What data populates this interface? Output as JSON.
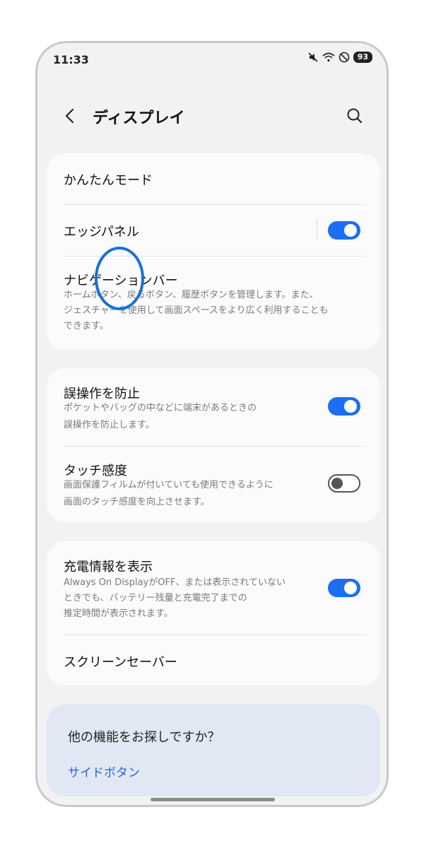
{
  "status_bar": {
    "time": "11:33",
    "battery": "93",
    "icons": [
      "mute-icon",
      "wifi-icon",
      "do-not-disturb-icon",
      "battery-icon"
    ]
  },
  "header": {
    "title": "ディスプレイ",
    "back_icon": "back-chevron-icon",
    "search_icon": "search-icon"
  },
  "group1": {
    "easy_mode": "かんたんモード",
    "edge_panel": {
      "title": "エッジパネル",
      "enabled": true
    },
    "nav_bar": {
      "title": "ナビゲーションバー",
      "sub_line1": "ホームボタン、戻るボタン、履歴ボタンを管理します。また、",
      "sub_line2": "ジェスチャーを使用して画面スペースをより広く利用することも",
      "sub_line3": "できます。"
    }
  },
  "group2": {
    "accidental_touch": {
      "title": "誤操作を防止",
      "sub_line1": "ポケットやバッグの中などに端末があるときの",
      "sub_line2": "誤操作を防止します。",
      "enabled": true
    },
    "touch_sensitivity": {
      "title": "タッチ感度",
      "sub_line1": "画面保護フィルムが付いていても使用できるように",
      "sub_line2": "画面のタッチ感度を向上させます。",
      "enabled": false
    }
  },
  "group3": {
    "charging_info": {
      "title": "充電情報を表示",
      "sub_line1": "Always On DisplayがOFF、または表示されていない",
      "sub_line2": "ときでも、バッテリー残量と充電完了までの",
      "sub_line3": "推定時間が表示されます。",
      "enabled": true
    },
    "screen_saver": "スクリーンセーバー"
  },
  "suggestions": {
    "title": "他の機能をお探しですか？",
    "link": "サイドボタン"
  },
  "colors": {
    "accent": "#1c6ef3",
    "link": "#2a63d4",
    "background": "#f2f2f4",
    "card": "#fbfbfd",
    "suggest_bg": "#e1e8f4"
  }
}
